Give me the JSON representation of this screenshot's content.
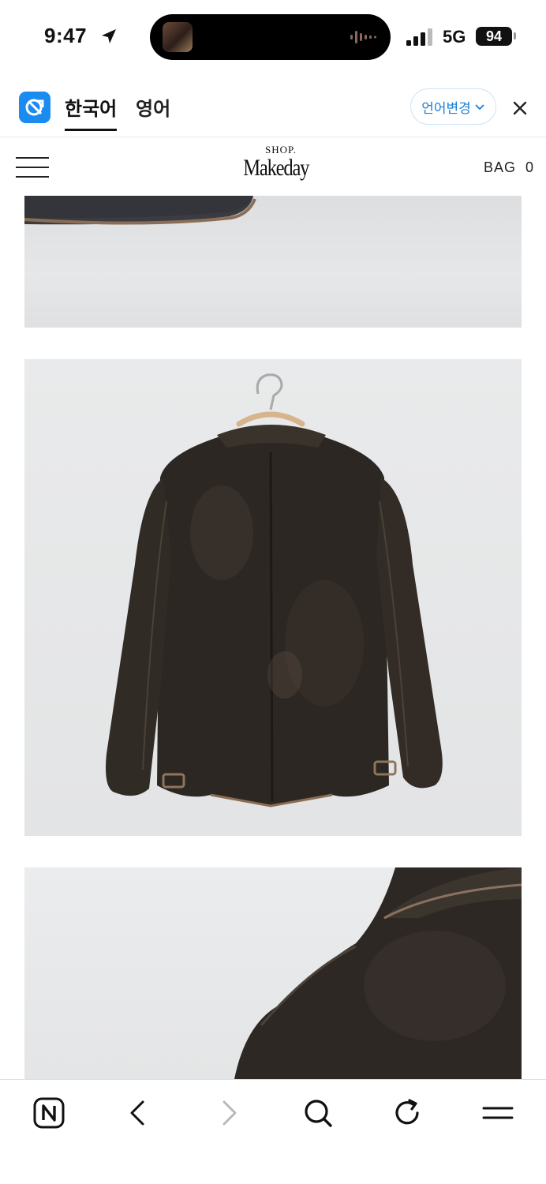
{
  "status_bar": {
    "time": "9:47",
    "network": "5G",
    "battery": "94"
  },
  "translate_bar": {
    "lang_korean": "한국어",
    "lang_english": "영어",
    "change_language": "언어변경",
    "accent_color": "#1a8cf0"
  },
  "shop_header": {
    "logo_top": "SHOP.",
    "logo_main": "Makeday",
    "bag_label": "BAG",
    "bag_count": "0"
  },
  "icons": {
    "status": [
      "location-arrow-icon",
      "audio-wave-icon",
      "signal-icon",
      "battery-icon"
    ],
    "translate": [
      "translate-logo-icon",
      "chevron-down-icon",
      "close-icon"
    ],
    "header": [
      "hamburger-menu-icon"
    ],
    "toolbar": [
      "naver-home-icon",
      "back-icon",
      "forward-icon",
      "search-icon",
      "reload-icon",
      "menu-icon"
    ]
  }
}
